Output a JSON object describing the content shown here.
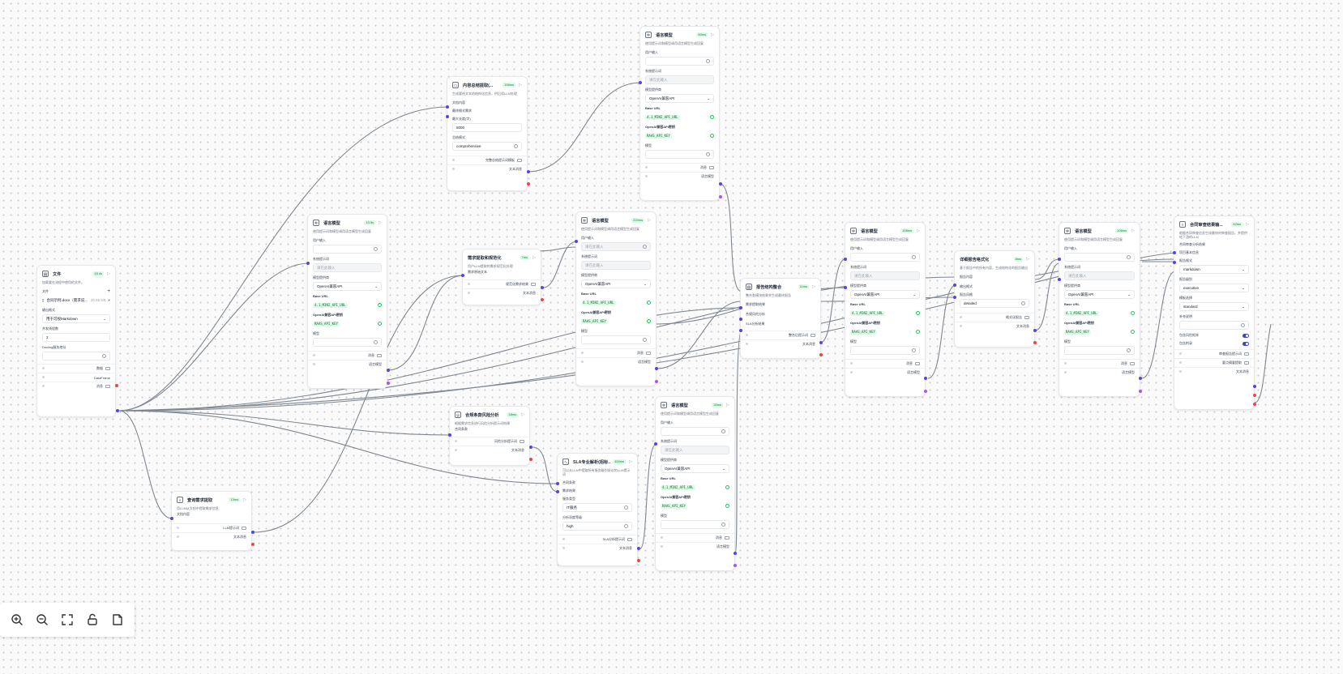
{
  "canvas": {
    "controls": {
      "zoom_in": "zoom-in-icon",
      "zoom_out": "zoom-out-icon",
      "fit": "fit-view-icon",
      "lock": "lock-icon",
      "minimap": "minimap-icon"
    }
  },
  "nodes": {
    "file": {
      "title": "文件",
      "badge": "15.4s",
      "desc": "加载要在流程中使用的文件。",
      "file_label": "文件",
      "file_name": "合同示例.docx（需求说...",
      "file_size": "20.55 KB",
      "output_format_label": "输出格式",
      "output_format_value": "用于可视Markdown",
      "concurrency_label": "并发线程数",
      "concurrency_value": "2",
      "docling_label": "Docling服务地址",
      "out_data": "数据",
      "out_dataframe": "DataFrame",
      "out_message": "消息"
    },
    "query": {
      "title": "查询需求提取",
      "badge": "13ms",
      "desc": "用LLM从文档中提取需求信息",
      "field1": "文档内容",
      "out1": "LLM提示词",
      "out2": "文本消息"
    },
    "llm1": {
      "title": "语言模型",
      "badge": "10.5s",
      "desc": "使用提示词和模型调用语言模型生成回复",
      "input_label": "用户输入",
      "system_label": "系统提示词",
      "system_value": "请在此输入",
      "provider_label": "模型提供商",
      "provider_value": "OpenAI兼容API",
      "base_url_label": "Base URL",
      "base_url_value": "4.1_MINI_API_URL",
      "key_label": "OpenAI兼容API密钥",
      "key_value": "RAAS_API_KEY",
      "model_label": "模型",
      "out1": "消息",
      "out2": "语言模型"
    },
    "summary": {
      "title": "内容总结提取(...",
      "badge": "156ms",
      "desc": "生成要给文本的结构化信息，供后续LLM处理",
      "field1": "文档内容",
      "field2": "最终格式需求",
      "len_label": "最大长度(字)",
      "len_value": "5000",
      "mode_label": "总结模式",
      "mode_value": "comprehensive",
      "out1": "完整总结提示词模板",
      "out2": "文本消息"
    },
    "extract": {
      "title": "需求提取和规范化",
      "badge": "7ms",
      "desc": "用户LLM提取的需求规范化处理",
      "field1": "需求原始文本",
      "out1": "规范化需求结果",
      "out2": "文本消息"
    },
    "llm2": {
      "title": "语言模型",
      "badge": "60ms",
      "desc": "使用提示词和模型调用语言模型生成回复",
      "input_label": "用户输入",
      "system_label": "系统提示词",
      "system_value": "请在此输入",
      "provider_label": "模型提供商",
      "provider_value": "OpenAI兼容API",
      "base_url_label": "Base URL",
      "base_url_value": "4.1_MINI_API_URL",
      "key_label": "OpenAI兼容API密钥",
      "key_value": "RAAS_API_KEY",
      "model_label": "模型",
      "out1": "消息",
      "out2": "语言模型"
    },
    "llm3": {
      "title": "语言模型",
      "badge": "220ms",
      "desc": "使用提示词和模型调用语言模型生成回复",
      "input_label": "用户输入",
      "input_value": "请在此输入",
      "system_label": "系统提示词",
      "system_value": "请在此输入",
      "provider_label": "模型提供商",
      "provider_value": "OpenAI兼容API",
      "base_url_label": "Base URL",
      "base_url_value": "4.1_MINI_API_URL",
      "key_label": "OpenAI兼容API密钥",
      "key_value": "RAAS_API_KEY",
      "model_label": "模型",
      "out1": "消息",
      "out2": "语言模型"
    },
    "risk": {
      "title": "合规条款风险分析",
      "badge": "18ms",
      "desc": "根据需求信息进行风险分析提示词构建",
      "field1": "合同条款",
      "out1": "风险分析提示词",
      "out2": "文本消息"
    },
    "sla": {
      "title": "SLA专业解析(招标...",
      "badge": "400ms",
      "desc": "可以从LLM中提取所有服务级别协议的LLM提示词",
      "field1": "合同条款",
      "field2": "需求结果",
      "type_label": "服务类型",
      "type_value": "IT服务",
      "level_label": "分析深度等级",
      "level_value": "high",
      "out1": "SLA分析提示词",
      "out2": "文本消息"
    },
    "llm4": {
      "title": "语言模型",
      "badge": "30ms",
      "desc": "使用提示词和模型调用语言模型生成回复",
      "input_label": "用户输入",
      "system_label": "系统提示词",
      "system_value": "请在此输入",
      "provider_label": "模型提供商",
      "provider_value": "OpenAI兼容API",
      "base_url_label": "Base URL",
      "base_url_value": "4.1_MINI_API_URL",
      "key_label": "OpenAI兼容API密钥",
      "key_value": "RAAS_API_KEY",
      "model_label": "模型",
      "out1": "消息",
      "out2": "语言模型"
    },
    "merge": {
      "title": "报告结构整合",
      "badge": "11ms",
      "desc": "整合各模块结果并生成最终报告",
      "field1": "需求提取结果",
      "field2": "合规风险分析",
      "field3": "SLA分析结果",
      "out1": "整合后提示词",
      "out2": "文本消息"
    },
    "llm5": {
      "title": "语言模型",
      "badge": "108ms",
      "desc": "使用提示词和模型调用语言模型生成回复",
      "input_label": "用户输入",
      "system_label": "系统提示词",
      "system_value": "请在此输入",
      "provider_label": "模型提供商",
      "provider_value": "OpenAI兼容API",
      "base_url_label": "Base URL",
      "base_url_value": "4.1_MINI_API_URL",
      "key_label": "OpenAI兼容API密钥",
      "key_value": "RAAS_API_KEY",
      "model_label": "模型",
      "out1": "消息",
      "out2": "语言模型"
    },
    "format": {
      "title": "详细报告格式化",
      "badge": "8ms",
      "desc": "基于报告中的所有内容，生成结构化的报告输出",
      "field1": "报告内容",
      "field2": "输出格式",
      "style_label": "报告风格",
      "style_value": "detailed",
      "out1": "格式化报告",
      "out2": "文本消息"
    },
    "llm6": {
      "title": "语言模型",
      "badge": "108ms",
      "desc": "使用提示词和模型调用语言模型生成回复",
      "input_label": "用户输入",
      "system_label": "系统提示词",
      "system_value": "请在此输入",
      "provider_label": "模型提供商",
      "provider_value": "OpenAI兼容API",
      "base_url_label": "Base URL",
      "base_url_value": "4.1_MINI_API_URL",
      "key_label": "OpenAI兼容API密钥",
      "key_value": "RAAS_API_KEY",
      "model_label": "模型",
      "out1": "消息",
      "out2": "语言模型"
    },
    "final": {
      "title": "合同审查结果输...",
      "badge": "62ms",
      "desc": "根据合同审查信息生成最终的审查报告，并提供给下游的LLM",
      "field1": "合同审查分析结果",
      "field2": "项目基本信息",
      "format_label": "报告格式",
      "format_value": "markdown",
      "level_label": "报告级别",
      "level_value": "executive",
      "template_label": "模板选择",
      "template_value": "standard",
      "extra_label": "补充说明",
      "toggle1_label": "包含风险矩阵",
      "toggle2_label": "包含附录",
      "out1": "审查报告提示词",
      "out2": "要点摘要提取",
      "out3": "文本消息"
    }
  }
}
